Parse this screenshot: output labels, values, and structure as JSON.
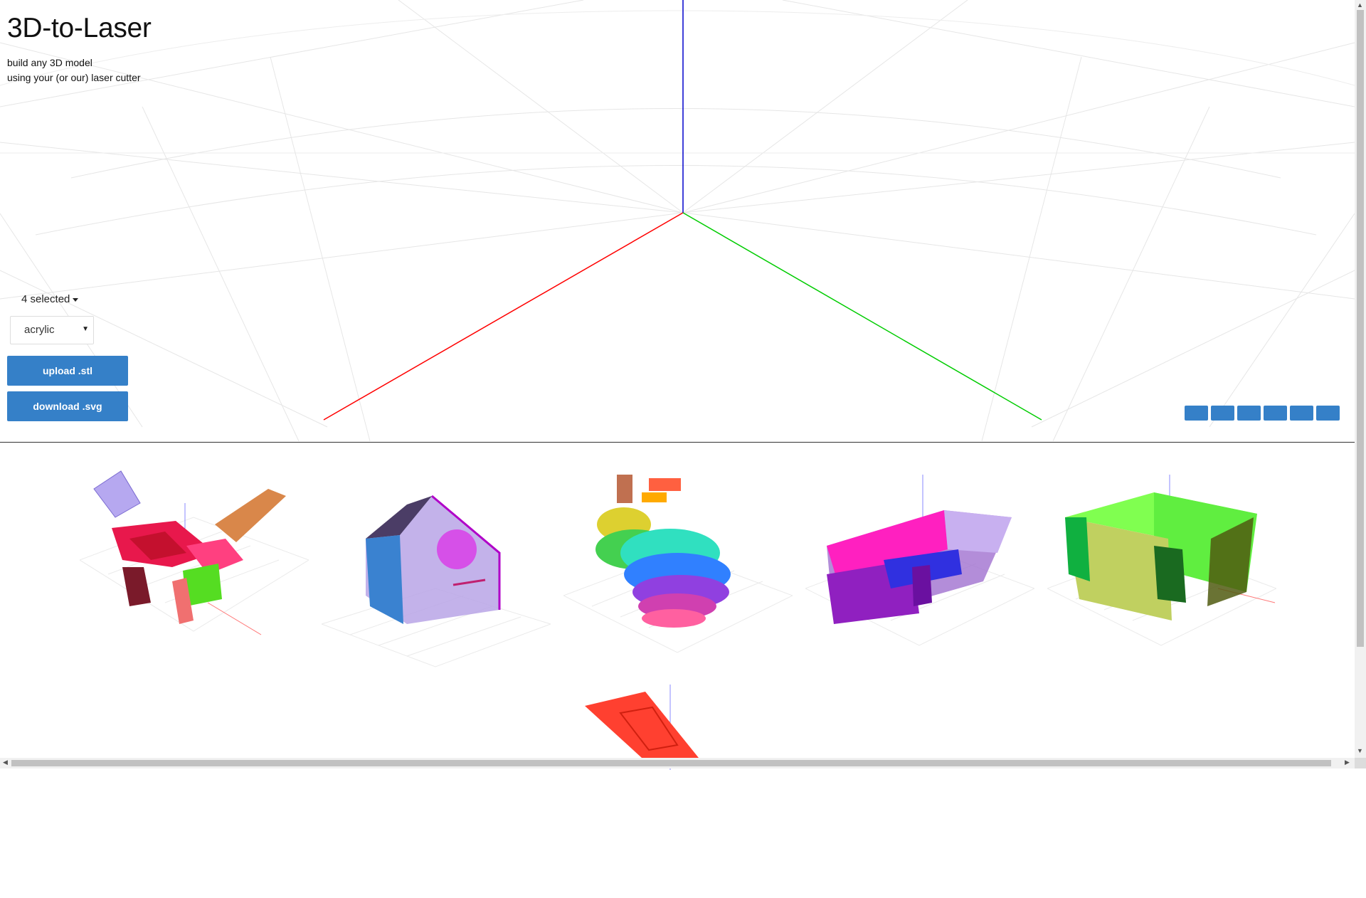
{
  "app": {
    "title": "3D-to-Laser",
    "tagline_1": "build any 3D model",
    "tagline_2": "using your (or our) laser cutter"
  },
  "controls": {
    "selected_label": "4 selected",
    "material_value": "acrylic",
    "upload_label": "upload .stl",
    "download_label": "download .svg"
  },
  "view_buttons": [
    "view-1",
    "view-2",
    "view-3",
    "view-4",
    "view-5",
    "view-6"
  ],
  "colors": {
    "accent": "#3580c8",
    "axis_x": "#ff0000",
    "axis_y": "#00cc00",
    "axis_z": "#0000cc"
  },
  "gallery": {
    "thumbnails": [
      "robot-arm-model",
      "birdhouse-model",
      "bunny-model",
      "boat-model",
      "box-model",
      "flat-plate-model"
    ]
  }
}
